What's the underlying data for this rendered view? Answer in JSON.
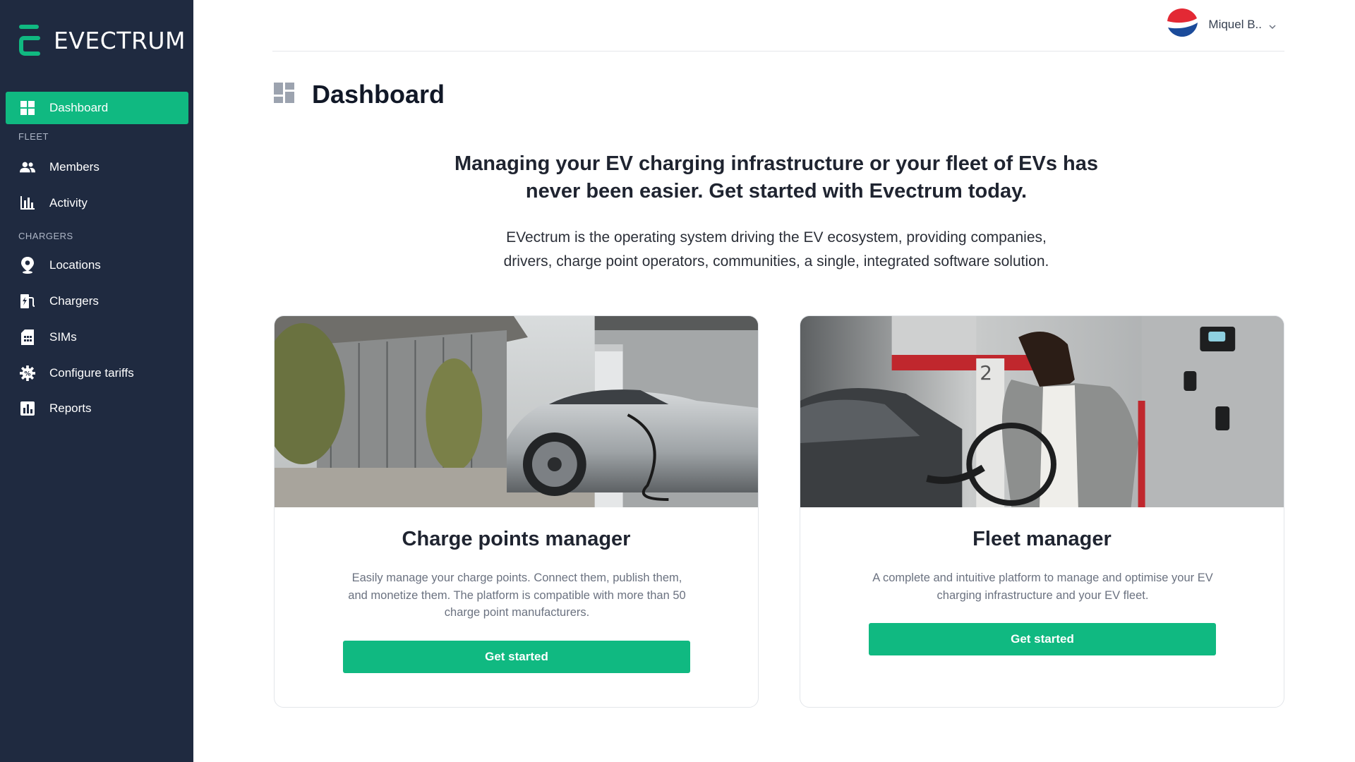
{
  "app": {
    "brand": "EVECTRUM",
    "accent": "#10b981",
    "sidebar_bg": "#1f2a40"
  },
  "sidebar": {
    "dashboard": {
      "label": "Dashboard",
      "icon": "dashboard-icon"
    },
    "fleet_header": "FLEET",
    "fleet_items": [
      {
        "label": "Members",
        "icon": "members-icon"
      },
      {
        "label": "Activity",
        "icon": "activity-icon"
      }
    ],
    "chargers_header": "CHARGERS",
    "chargers_items": [
      {
        "label": "Locations",
        "icon": "location-pin-icon"
      },
      {
        "label": "Chargers",
        "icon": "charger-icon"
      },
      {
        "label": "SIMs",
        "icon": "sim-icon"
      },
      {
        "label": "Configure tariffs",
        "icon": "gear-icon"
      },
      {
        "label": "Reports",
        "icon": "reports-icon"
      }
    ]
  },
  "header": {
    "user_name": "Miquel B..",
    "user_menu_icon": "chevron-down-icon",
    "avatar_icon": "pepsi-logo-avatar"
  },
  "page": {
    "title": "Dashboard",
    "title_icon": "dashboard-icon",
    "hero_title_line1": "Managing your EV charging infrastructure or your fleet of EVs has",
    "hero_title_line2": "never been easier. Get started with Evectrum today.",
    "hero_sub_line1": "EVectrum is the operating system driving the EV ecosystem, providing companies,",
    "hero_sub_line2": "drivers, charge point operators, communities, a single, integrated software solution."
  },
  "cards": [
    {
      "title": "Charge points manager",
      "description": "Easily manage your charge points. Connect them, publish them, and monetize them. The platform is compatible with more than 50 charge point manufacturers.",
      "button": "Get started"
    },
    {
      "title": "Fleet manager",
      "description": "A complete and intuitive platform to manage and optimise your EV charging infrastructure and your EV fleet.",
      "button": "Get started"
    }
  ]
}
